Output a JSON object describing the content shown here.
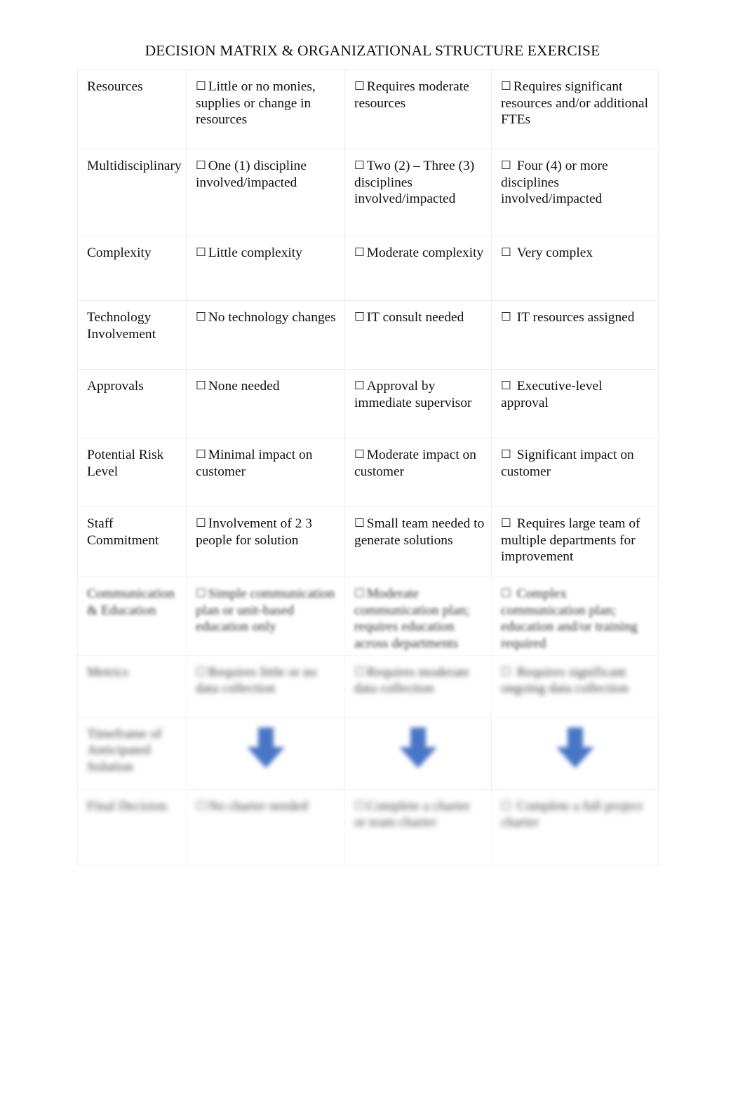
{
  "document": {
    "title": "DECISION MATRIX & ORGANIZATIONAL STRUCTURE EXERCISE"
  },
  "icons": {
    "checkbox": "☐",
    "down_arrow": "down-arrow-icon"
  },
  "colors": {
    "arrow_blue": "#3f6fc3",
    "text": "#121112",
    "border": "#ececed",
    "page_background": "#ffffff"
  },
  "matrix": {
    "rows": [
      {
        "criterion": "Resources",
        "options": [
          "Little or no monies, supplies or change in resources",
          "Requires moderate resources",
          "Requires significant resources and/or additional FTEs"
        ],
        "legible": true
      },
      {
        "criterion": "Multidisciplinary",
        "options": [
          "One (1) discipline involved/impacted",
          "Two (2) – Three (3) disciplines involved/impacted",
          "Four (4) or more disciplines involved/impacted"
        ],
        "legible": true
      },
      {
        "criterion": "Complexity",
        "options": [
          "Little complexity",
          "Moderate complexity",
          "Very complex"
        ],
        "legible": true
      },
      {
        "criterion": "Technology Involvement",
        "options": [
          "No technology changes",
          "IT consult needed",
          "IT resources assigned"
        ],
        "legible": true
      },
      {
        "criterion": "Approvals",
        "options": [
          "None needed",
          "Approval by immediate supervisor",
          "Executive-level approval"
        ],
        "legible": true
      },
      {
        "criterion": "Potential Risk Level",
        "options": [
          "Minimal impact on customer",
          "Moderate impact on customer",
          "Significant impact on customer"
        ],
        "legible": true
      },
      {
        "criterion": "Staff Commitment",
        "options": [
          "Involvement of 2 3 people for solution",
          "Small team needed to generate solutions",
          "Requires large team of multiple departments for improvement"
        ],
        "legible": true
      },
      {
        "criterion": "Communication & Education",
        "options": [
          "Simple communication plan or unit-based education only",
          "Moderate communication plan; requires education across departments",
          "Complex communication plan; education and/or training required"
        ],
        "legible": "partial"
      },
      {
        "criterion": "Metrics",
        "options": [
          "Requires little or no data collection",
          "Requires moderate data collection",
          "Requires significant ongoing data collection"
        ],
        "legible": false
      },
      {
        "criterion": "Timeframe of Anticipated Solution",
        "options": [
          "",
          "",
          ""
        ],
        "legible": false,
        "arrow_row": true
      },
      {
        "criterion": "Final Decision",
        "options": [
          "No charter needed",
          "Complete a charter or team charter",
          "Complete a full project charter"
        ],
        "legible": false
      }
    ]
  }
}
